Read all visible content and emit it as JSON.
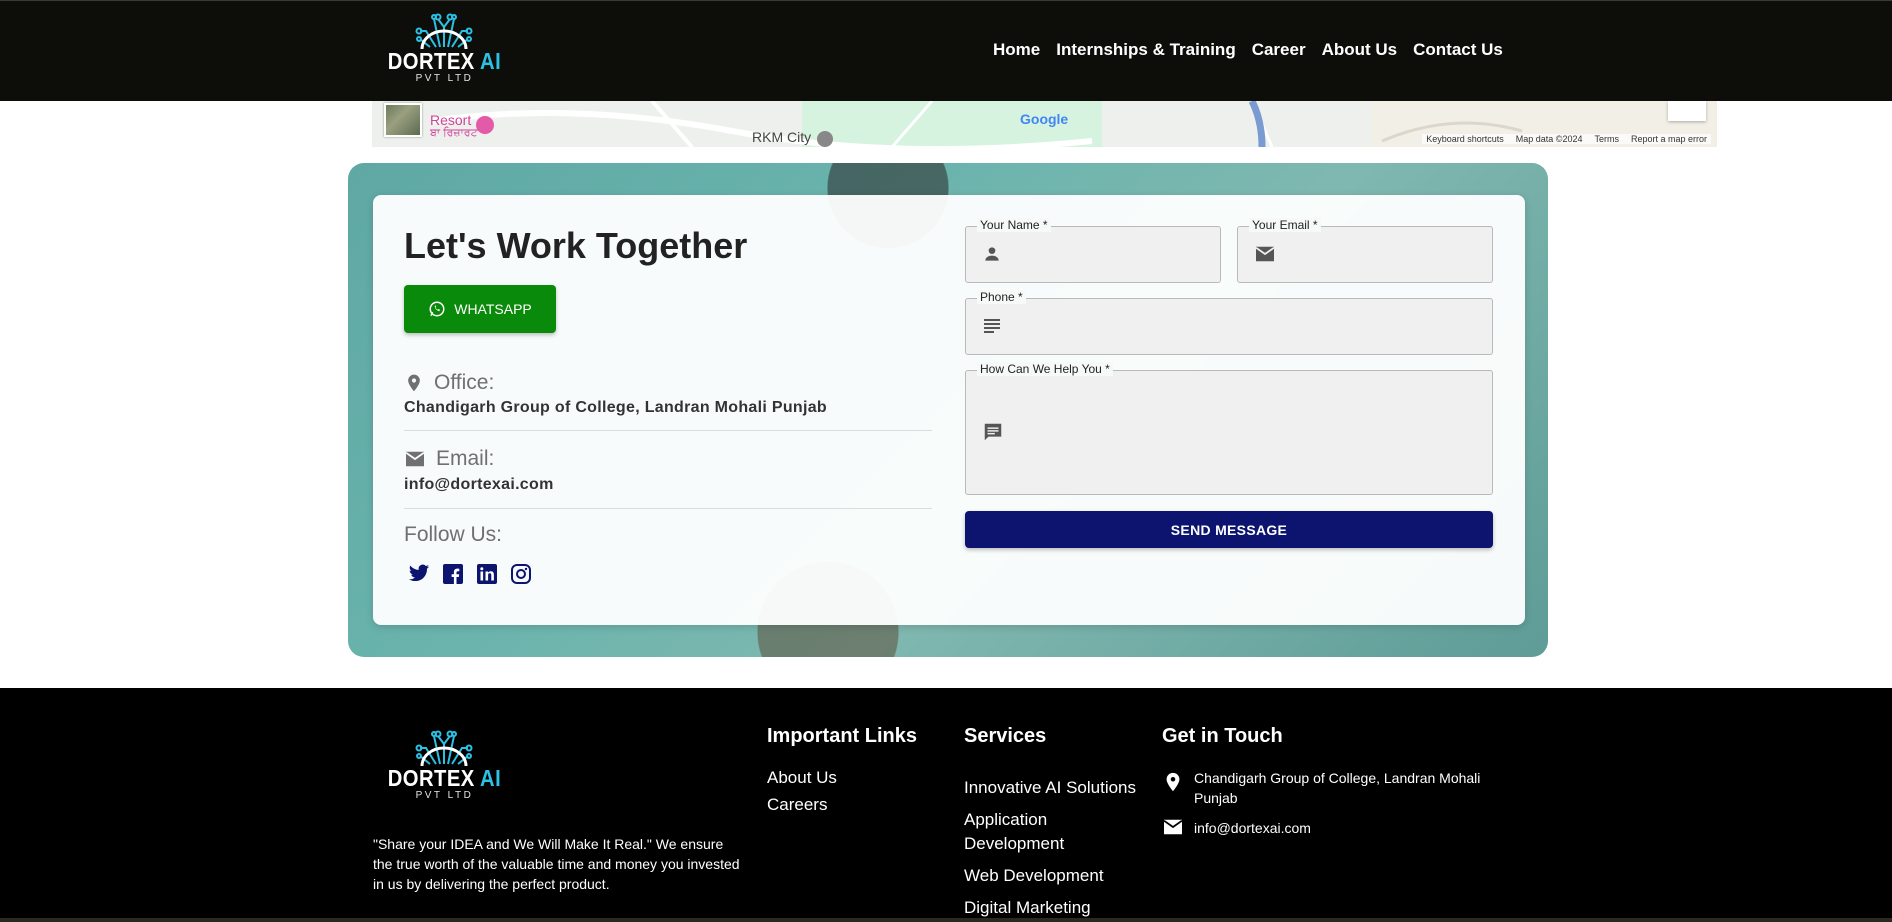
{
  "header": {
    "logo": {
      "brand": "DORTEX",
      "brand_accent": "AI",
      "sub": "PVT LTD"
    },
    "nav": [
      {
        "label": "Home"
      },
      {
        "label": "Internships & Training"
      },
      {
        "label": "Career"
      },
      {
        "label": "About Us"
      },
      {
        "label": "Contact Us"
      }
    ]
  },
  "map": {
    "poi_resort": "Resort",
    "poi_resort_local": "ਬਾ ਰਿਜ਼ਾਰਟ",
    "poi_rkm": "RKM City",
    "google": "Google",
    "attribution": [
      "Keyboard shortcuts",
      "Map data ©2024",
      "Terms",
      "Report a map error"
    ]
  },
  "contact": {
    "heading": "Let's Work Together",
    "whatsapp_label": "WHATSAPP",
    "office_label": "Office:",
    "office_value": "Chandigarh Group of College, Landran Mohali Punjab",
    "email_label": "Email:",
    "email_value": "info@dortexai.com",
    "follow_label": "Follow Us:",
    "socials": [
      "twitter-icon",
      "facebook-icon",
      "linkedin-icon",
      "instagram-icon"
    ],
    "form": {
      "name_label": "Your Name *",
      "name_value": "",
      "email_label": "Your Email *",
      "email_value": "",
      "phone_label": "Phone *",
      "phone_value": "",
      "help_label": "How Can We Help You *",
      "help_value": "",
      "send_label": "SEND MESSAGE"
    }
  },
  "footer": {
    "logo": {
      "brand": "DORTEX",
      "brand_accent": "AI",
      "sub": "PVT LTD"
    },
    "tagline": "\"Share your IDEA and We Will Make It Real.\" We ensure the true worth of the valuable time and money you invested in us by delivering the perfect product.",
    "important_links_title": "Important Links",
    "important_links": [
      "About Us",
      "Careers"
    ],
    "services_title": "Services",
    "services": [
      "Innovative AI Solutions",
      "Application Development",
      "Web Development",
      "Digital Marketing"
    ],
    "get_in_touch_title": "Get in Touch",
    "address": "Chandigarh Group of College, Landran Mohali Punjab",
    "email": "info@dortexai.com"
  },
  "colors": {
    "header_bg": "#0d0d09",
    "accent_cyan": "#2bc0e4",
    "whatsapp_green": "#0a8a0a",
    "send_navy": "#0d1470",
    "section_teal": "#6ab4ad",
    "social_navy": "#0d1470"
  }
}
